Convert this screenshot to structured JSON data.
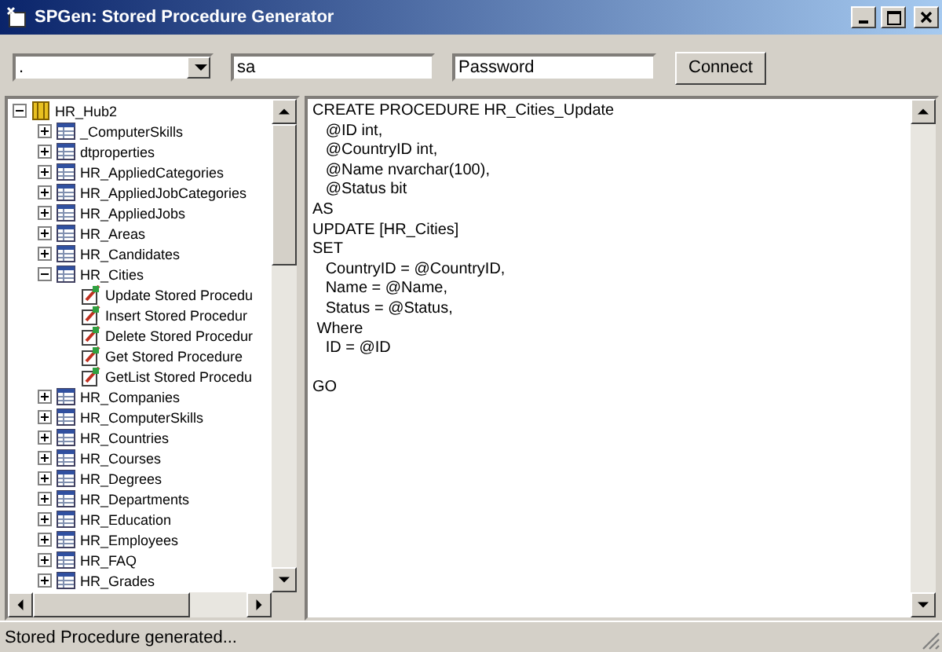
{
  "window": {
    "title": "SPGen: Stored Procedure Generator"
  },
  "connection": {
    "server": ".",
    "user": "sa",
    "password": "Password",
    "button": "Connect"
  },
  "tree": [
    {
      "label": "HR_Hub2",
      "kind": "database",
      "expanded": true,
      "children": [
        {
          "label": "_ComputerSkills",
          "kind": "table",
          "expanded": false
        },
        {
          "label": "dtproperties",
          "kind": "table",
          "expanded": false
        },
        {
          "label": "HR_AppliedCategories",
          "kind": "table",
          "expanded": false
        },
        {
          "label": "HR_AppliedJobCategories",
          "kind": "table",
          "expanded": false
        },
        {
          "label": "HR_AppliedJobs",
          "kind": "table",
          "expanded": false
        },
        {
          "label": "HR_Areas",
          "kind": "table",
          "expanded": false
        },
        {
          "label": "HR_Candidates",
          "kind": "table",
          "expanded": false
        },
        {
          "label": "HR_Cities",
          "kind": "table",
          "expanded": true,
          "children": [
            {
              "label": "Update Stored Procedu",
              "kind": "procedure"
            },
            {
              "label": "Insert Stored Procedur",
              "kind": "procedure"
            },
            {
              "label": "Delete Stored Procedur",
              "kind": "procedure"
            },
            {
              "label": "Get Stored Procedure",
              "kind": "procedure"
            },
            {
              "label": "GetList Stored Procedu",
              "kind": "procedure"
            }
          ]
        },
        {
          "label": "HR_Companies",
          "kind": "table",
          "expanded": false
        },
        {
          "label": "HR_ComputerSkills",
          "kind": "table",
          "expanded": false
        },
        {
          "label": "HR_Countries",
          "kind": "table",
          "expanded": false
        },
        {
          "label": "HR_Courses",
          "kind": "table",
          "expanded": false
        },
        {
          "label": "HR_Degrees",
          "kind": "table",
          "expanded": false
        },
        {
          "label": "HR_Departments",
          "kind": "table",
          "expanded": false
        },
        {
          "label": "HR_Education",
          "kind": "table",
          "expanded": false
        },
        {
          "label": "HR_Employees",
          "kind": "table",
          "expanded": false
        },
        {
          "label": "HR_FAQ",
          "kind": "table",
          "expanded": false
        },
        {
          "label": "HR_Grades",
          "kind": "table",
          "expanded": false
        }
      ]
    }
  ],
  "code": [
    {
      "lines": [
        "CREATE PROCEDURE HR_Cities_Update",
        "   @ID int,",
        "   @CountryID int,",
        "   @Name nvarchar(100),",
        "   @Status bit",
        "AS",
        "UPDATE [HR_Cities]",
        "SET",
        "   CountryID = @CountryID,",
        "   Name = @Name,",
        "   Status = @Status,",
        " Where",
        "   ID = @ID"
      ]
    },
    {
      "lines": [
        "GO"
      ]
    }
  ],
  "status_bar": "Stored Procedure generated..."
}
